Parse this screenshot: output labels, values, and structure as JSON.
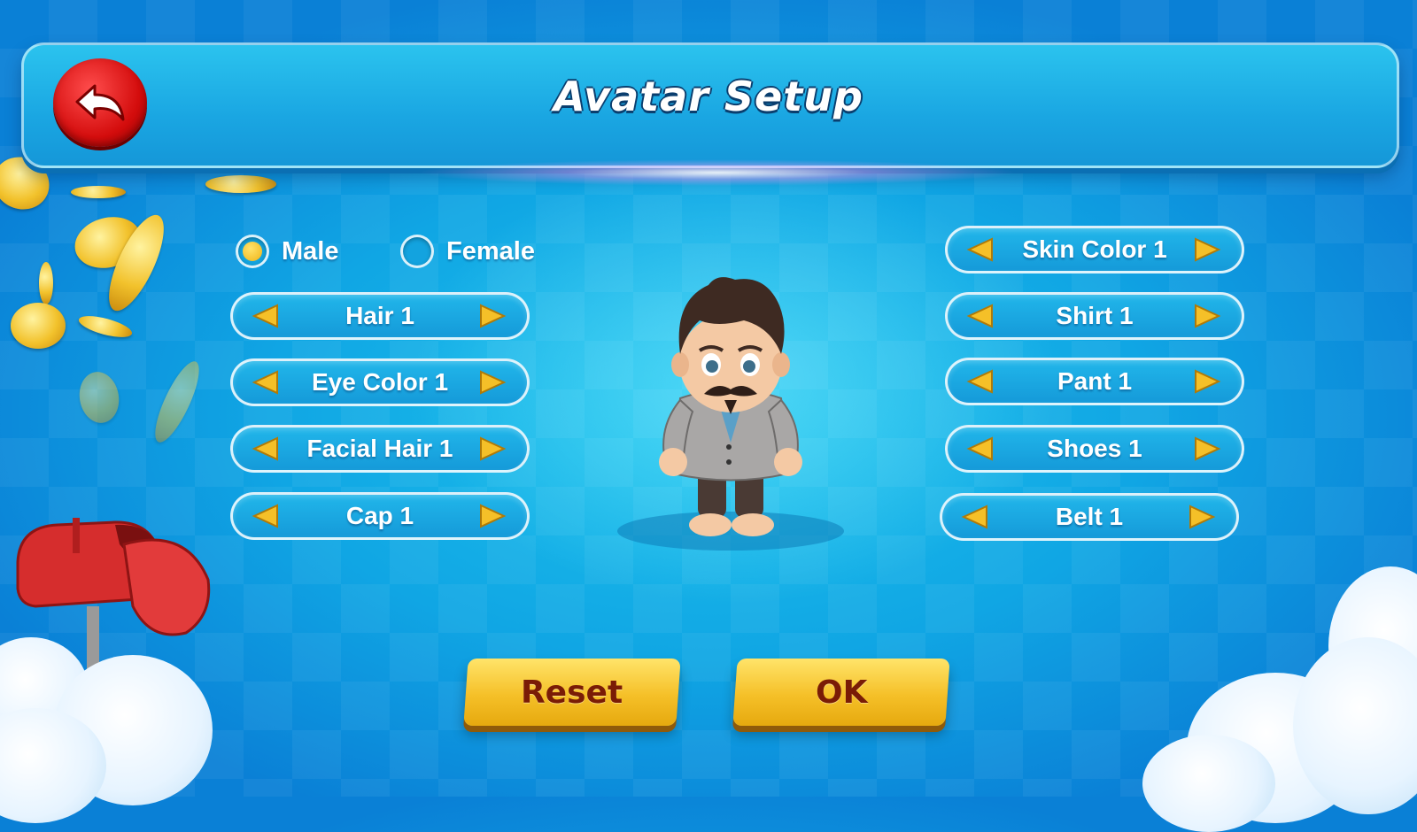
{
  "header": {
    "title": "Avatar Setup",
    "back_icon": "back-arrow-icon"
  },
  "gender": {
    "options": [
      {
        "label": "Male",
        "selected": true
      },
      {
        "label": "Female",
        "selected": false
      }
    ]
  },
  "left_options": [
    "Hair 1",
    "Eye Color 1",
    "Facial Hair 1",
    "Cap 1"
  ],
  "right_options": [
    "Skin Color 1",
    "Shirt 1",
    "Pant 1",
    "Shoes 1",
    "Belt 1"
  ],
  "buttons": {
    "reset": "Reset",
    "ok": "OK"
  },
  "colors": {
    "accent_yellow": "#f5c028",
    "back_red": "#d40d0d",
    "button_text": "#7a1c06",
    "background": "#10a6e4"
  },
  "icons": {
    "prev": "arrow-left-icon",
    "next": "arrow-right-icon",
    "decor": [
      "gold-coin-icon",
      "mailbox-icon",
      "cloud-icon"
    ]
  }
}
